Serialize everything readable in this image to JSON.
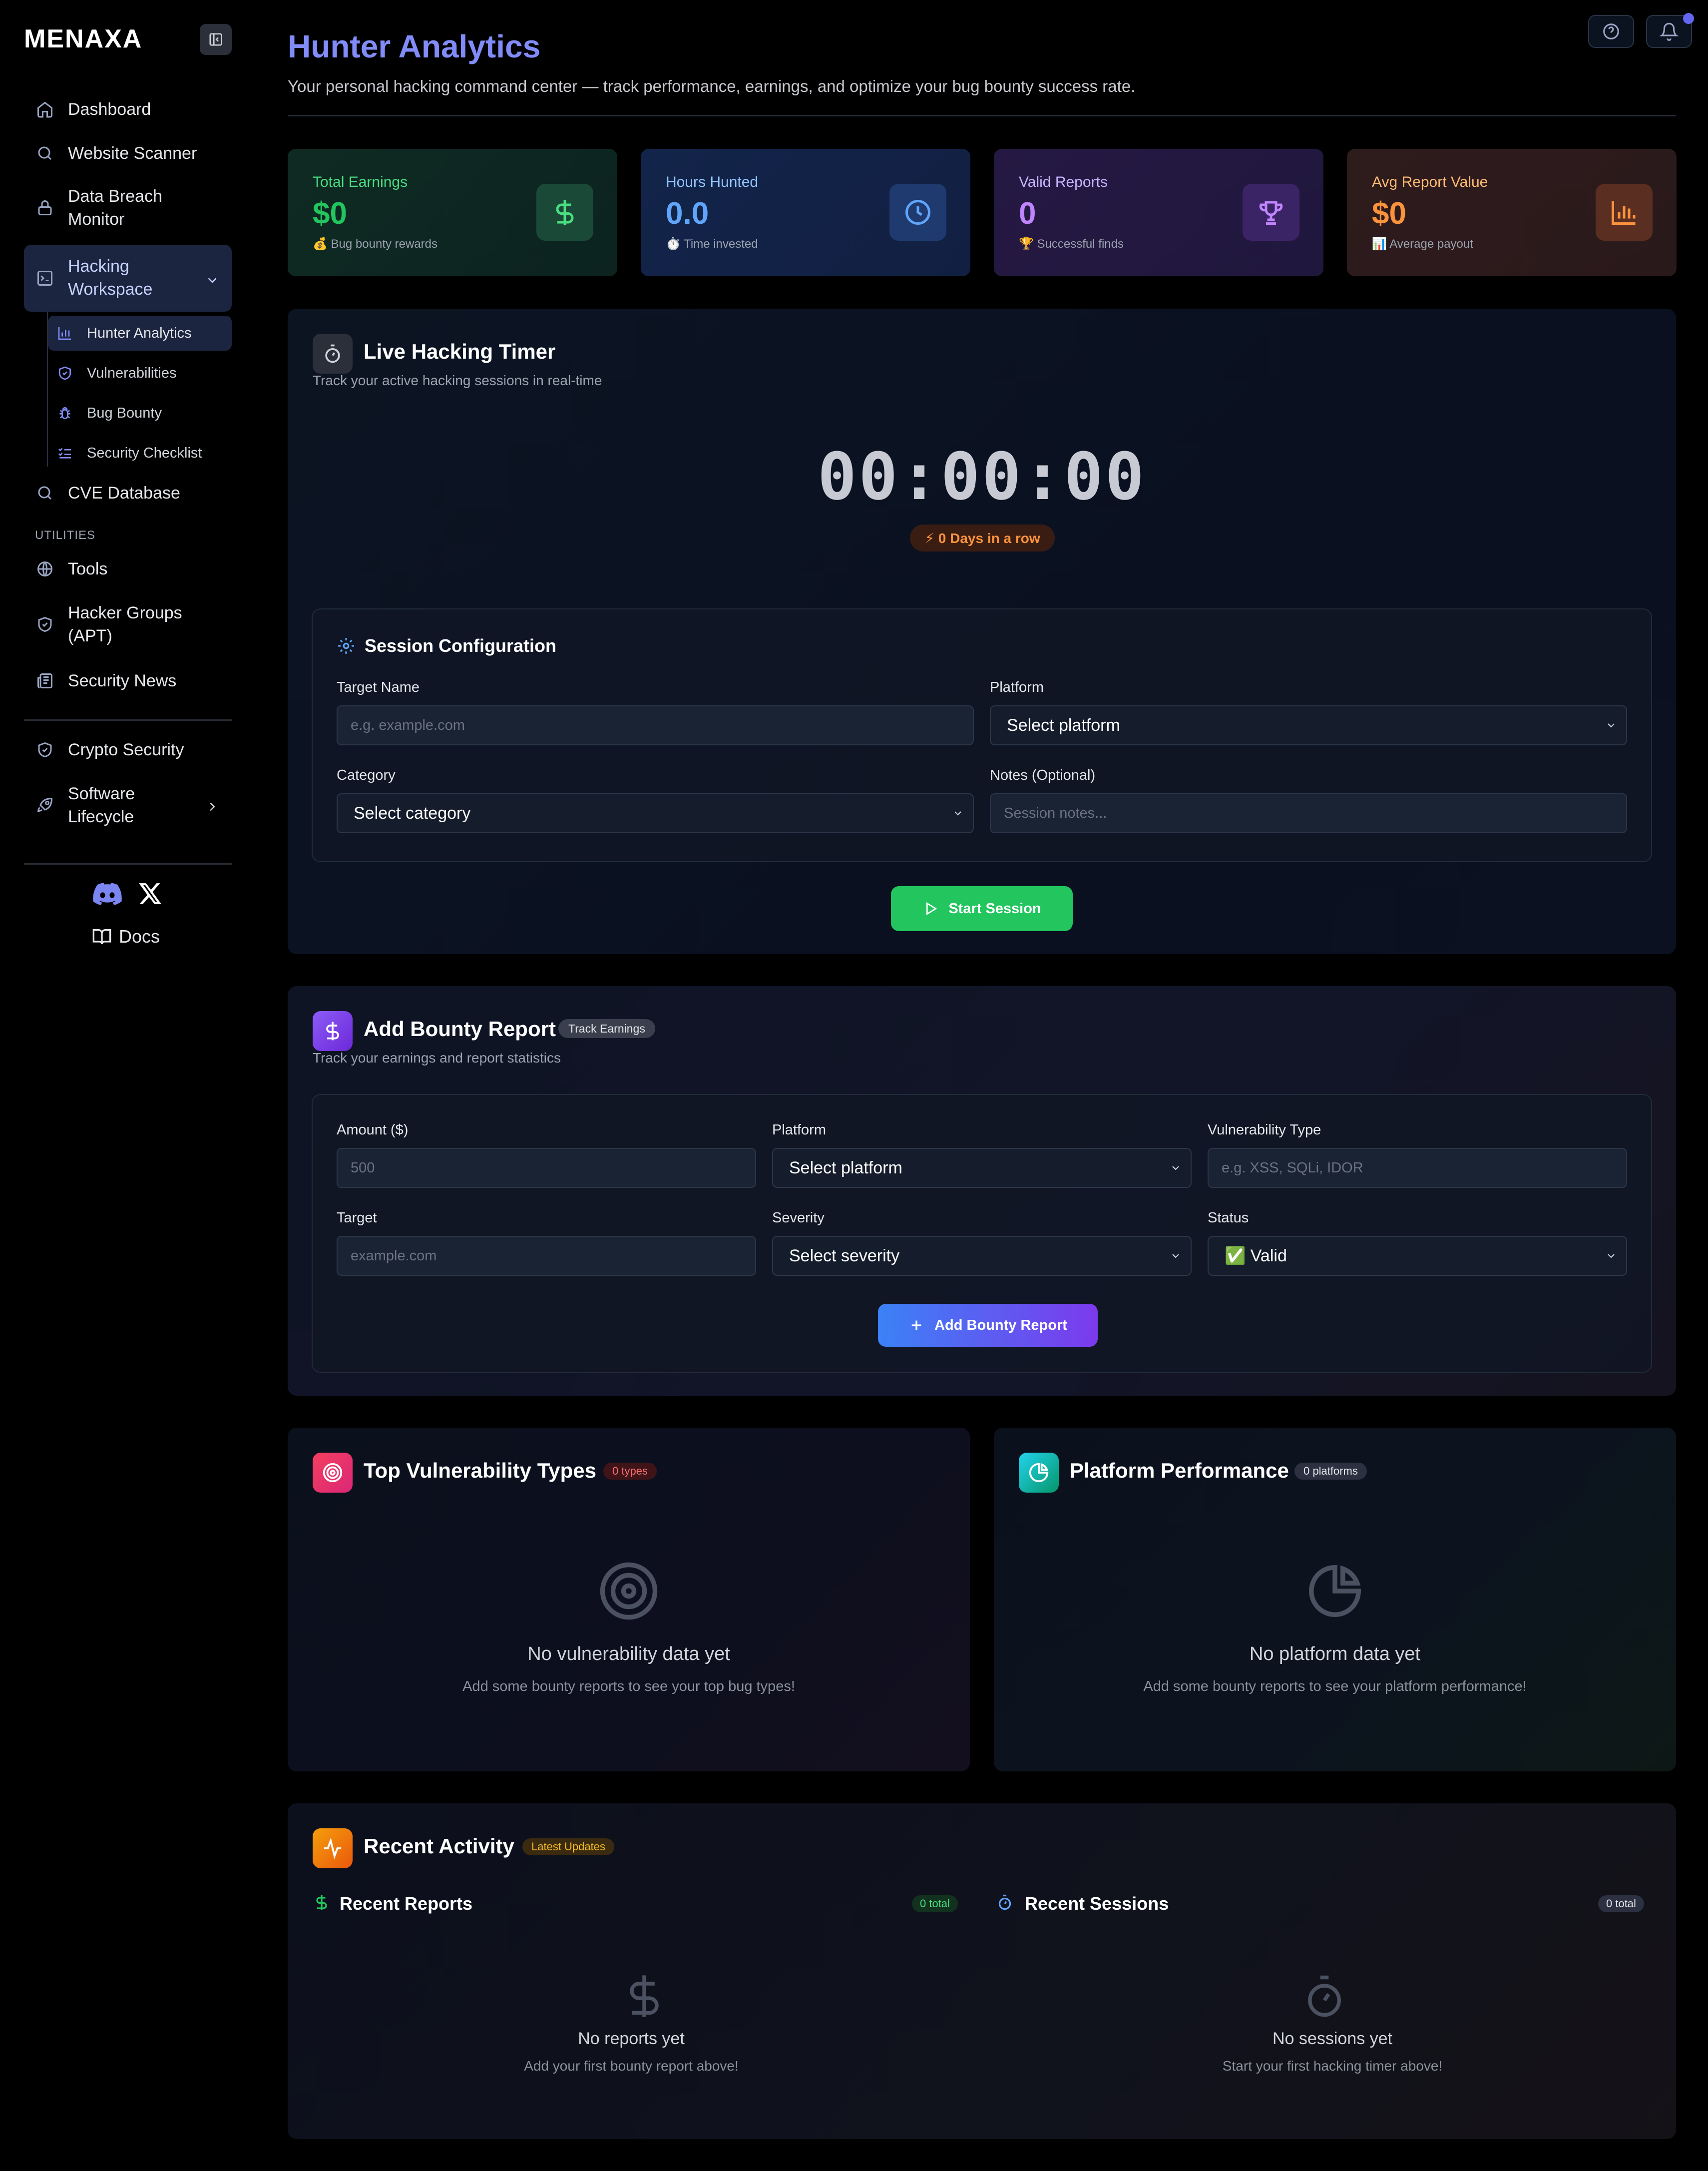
{
  "sidebar": {
    "brand": "MENAXA",
    "items": {
      "dashboard": "Dashboard",
      "website_scanner": "Website Scanner",
      "data_breach_line1": "Data Breach",
      "data_breach_line2": "Monitor",
      "hacking_line1": "Hacking",
      "hacking_line2": "Workspace",
      "cve": "CVE Database",
      "tools": "Tools",
      "apt_line1": "Hacker Groups",
      "apt_line2": "(APT)",
      "news": "Security News",
      "crypto": "Crypto Security",
      "sdlc_line1": "Software",
      "sdlc_line2": "Lifecycle"
    },
    "sub_items": {
      "hunter": "Hunter Analytics",
      "vulns": "Vulnerabilities",
      "bounty": "Bug Bounty",
      "checklist": "Security Checklist"
    },
    "section_utilities": "UTILITIES",
    "docs": "Docs"
  },
  "header": {
    "title": "Hunter Analytics",
    "subtitle": "Your personal hacking command center — track performance, earnings, and optimize your bug bounty success rate."
  },
  "stats": {
    "earnings": {
      "label": "Total Earnings",
      "value": "$0",
      "note": "💰 Bug bounty rewards",
      "color": "#22c55e"
    },
    "hours": {
      "label": "Hours Hunted",
      "value": "0.0",
      "note": "⏱️ Time invested",
      "color": "#60a5fa"
    },
    "reports": {
      "label": "Valid Reports",
      "value": "0",
      "note": "🏆 Successful finds",
      "color": "#c084fc"
    },
    "avg": {
      "label": "Avg Report Value",
      "value": "$0",
      "note": "📊 Average payout",
      "color": "#fb923c"
    }
  },
  "timer": {
    "title": "Live Hacking Timer",
    "subtitle": "Track your active hacking sessions in real-time",
    "time": "00:00:00",
    "streak": "⚡ 0 Days in a row",
    "config_title": "Session Configuration",
    "target_label": "Target Name",
    "target_placeholder": "e.g. example.com",
    "platform_label": "Platform",
    "platform_value": "Select platform",
    "category_label": "Category",
    "category_value": "Select category",
    "notes_label": "Notes (Optional)",
    "notes_placeholder": "Session notes...",
    "start_button": "Start Session"
  },
  "bounty": {
    "title": "Add Bounty Report",
    "badge": "Track Earnings",
    "subtitle": "Track your earnings and report statistics",
    "amount_label": "Amount ($)",
    "amount_placeholder": "500",
    "platform_label": "Platform",
    "platform_value": "Select platform",
    "vuln_label": "Vulnerability Type",
    "vuln_placeholder": "e.g. XSS, SQLi, IDOR",
    "target_label": "Target",
    "target_placeholder": "example.com",
    "severity_label": "Severity",
    "severity_value": "Select severity",
    "status_label": "Status",
    "status_value": "✅ Valid",
    "add_button": "Add Bounty Report"
  },
  "vuln_types": {
    "title": "Top Vulnerability Types",
    "badge": "0 types",
    "empty_title": "No vulnerability data yet",
    "empty_sub": "Add some bounty reports to see your top bug types!"
  },
  "platform_perf": {
    "title": "Platform Performance",
    "badge": "0 platforms",
    "empty_title": "No platform data yet",
    "empty_sub": "Add some bounty reports to see your platform performance!"
  },
  "activity": {
    "title": "Recent Activity",
    "badge": "Latest Updates",
    "reports_title": "Recent Reports",
    "reports_badge": "0 total",
    "reports_empty_title": "No reports yet",
    "reports_empty_sub": "Add your first bounty report above!",
    "sessions_title": "Recent Sessions",
    "sessions_badge": "0 total",
    "sessions_empty_title": "No sessions yet",
    "sessions_empty_sub": "Start your first hacking timer above!"
  }
}
